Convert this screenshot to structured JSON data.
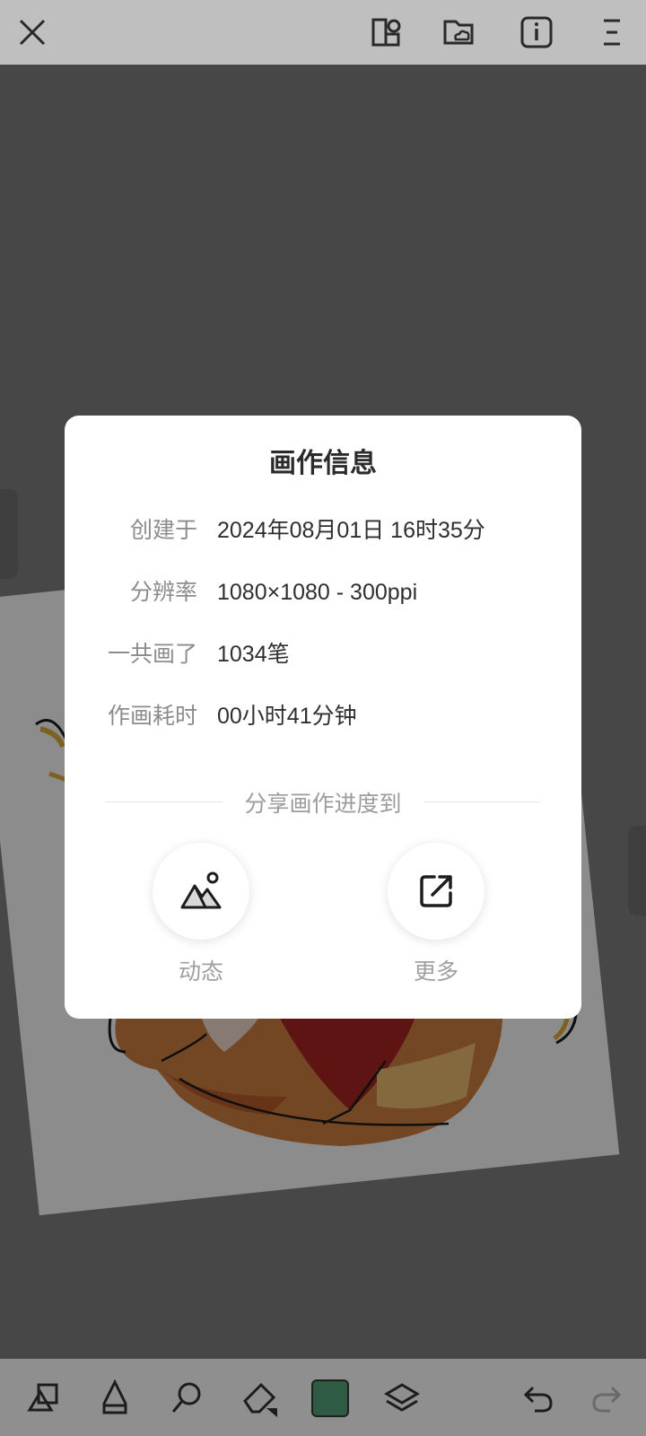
{
  "dialog": {
    "title": "画作信息",
    "rows": [
      {
        "label": "创建于",
        "value": "2024年08月01日 16时35分"
      },
      {
        "label": "分辨率",
        "value": "1080×1080 - 300ppi"
      },
      {
        "label": "一共画了",
        "value": "1034笔"
      },
      {
        "label": "作画耗时",
        "value": "00小时41分钟"
      }
    ],
    "share_label": "分享画作进度到",
    "share_targets": [
      {
        "label": "动态",
        "icon": "mountain-photo-icon"
      },
      {
        "label": "更多",
        "icon": "external-share-icon"
      }
    ]
  },
  "toolbar_top": {
    "icons": [
      "close-icon",
      "edit-page-icon",
      "cloud-folder-icon",
      "info-icon",
      "menu-icon"
    ]
  },
  "toolbar_bottom": {
    "icons": [
      "shapes-icon",
      "pencil-icon",
      "smudge-icon",
      "eraser-icon",
      "color-swatch",
      "layers-icon",
      "undo-icon",
      "redo-icon"
    ],
    "current_color": "#2f5a43"
  },
  "colors": {
    "background": "#666666",
    "dialog_bg": "#ffffff",
    "label_text": "#8c8c8c",
    "value_text": "#2f2f2f"
  }
}
